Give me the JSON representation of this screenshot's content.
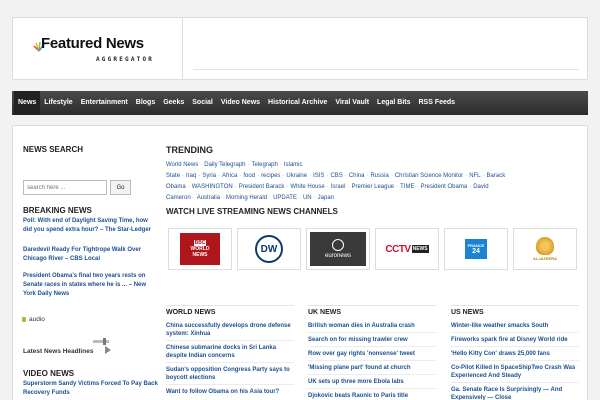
{
  "logo": {
    "title": "Featured News",
    "subtitle": "AGGREGATOR"
  },
  "nav": [
    "News",
    "Lifestyle",
    "Entertainment",
    "Blogs",
    "Geeks",
    "Social",
    "Video News",
    "Historical Archive",
    "Viral Vault",
    "Legal Bits",
    "RSS Feeds"
  ],
  "sidebar": {
    "news_search": "NEWS SEARCH",
    "search_placeholder": "search here ...",
    "go": "Go",
    "breaking_news": "BREAKING NEWS",
    "breaking_items": [
      "Poll: With end of Daylight Saving Time, how did you spend extra hour? – The Star-Ledger",
      "Daredevil Ready For Tightrope Walk Over Chicago River – CBS Local",
      "President Obama's final two years rests on Senate races in states where he is ... – New York Daily News"
    ],
    "audio": "audio",
    "latest_headlines": "Latest News Headlines",
    "video_news": "VIDEO NEWS",
    "video_items": [
      "Superstorm Sandy Victims Forced To Pay Back Recovery Funds"
    ]
  },
  "trending": {
    "heading": "TRENDING",
    "tags": [
      "World News",
      "Daily Telegraph",
      "Telegraph",
      "Islamic State",
      "Iraq",
      "Syria",
      "Africa",
      "food",
      "recipes",
      "Ukraine",
      "ISIS",
      "CBS",
      "China",
      "Russia",
      "Christian Science Monitor",
      "NFL",
      "Barack Obama",
      "WASHINGTON",
      "President Barack",
      "White House",
      "Israel",
      "Premier League",
      "TIME",
      "President Obama",
      "David Cameron",
      "Australia",
      "Morning Herald",
      "UPDATE",
      "UN",
      "Japan"
    ]
  },
  "live": {
    "heading": "WATCH LIVE STREAMING NEWS CHANNELS",
    "channels": [
      {
        "name": "BBC WORLD NEWS",
        "l1": "BBC",
        "l2": "WORLD",
        "l3": "NEWS"
      },
      {
        "name": "DW",
        "l1": "DW"
      },
      {
        "name": "euronews",
        "l1": "euronews"
      },
      {
        "name": "CCTV NEWS",
        "l1": "CCTV",
        "l2": "NEWS"
      },
      {
        "name": "FRANCE 24",
        "l1": "FRANCE",
        "l2": "24"
      },
      {
        "name": "ALJAZEERA",
        "l1": "ALJAZEERA"
      }
    ]
  },
  "columns": [
    {
      "heading": "WORLD NEWS",
      "items": [
        "China successfully develops drone defense system: Xinhua",
        "Chinese submarine docks in Sri Lanka despite Indian concerns",
        "Sudan's opposition Congress Party says to boycott elections",
        "Want to follow Obama on his Asia tour?"
      ]
    },
    {
      "heading": "UK NEWS",
      "items": [
        "British woman dies in Australia crash",
        "Search on for missing trawler crew",
        "Row over gay rights 'nonsense' tweet",
        "'Missing plane part' found at church",
        "UK sets up three more Ebola labs",
        "Djokovic beats Raonic to Paris title"
      ]
    },
    {
      "heading": "US NEWS",
      "items": [
        "Winter-like weather smacks South",
        "Fireworks spark fire at Disney World ride",
        "'Hello Kitty Con' draws 25,000 fans",
        "Co-Pilot Killed In SpaceShipTwo Crash Was Experienced And Steady",
        "Ga. Senate Race Is Surprisingly — And Expensively — Close"
      ]
    }
  ],
  "colors": {
    "link": "#1d4f8f",
    "nav_bg": "#3a3a3a",
    "bbc_red": "#b0141c",
    "cctv_red": "#c8102e",
    "f24_blue": "#1b83d4",
    "aljazeera_gold": "#d9a02a"
  }
}
